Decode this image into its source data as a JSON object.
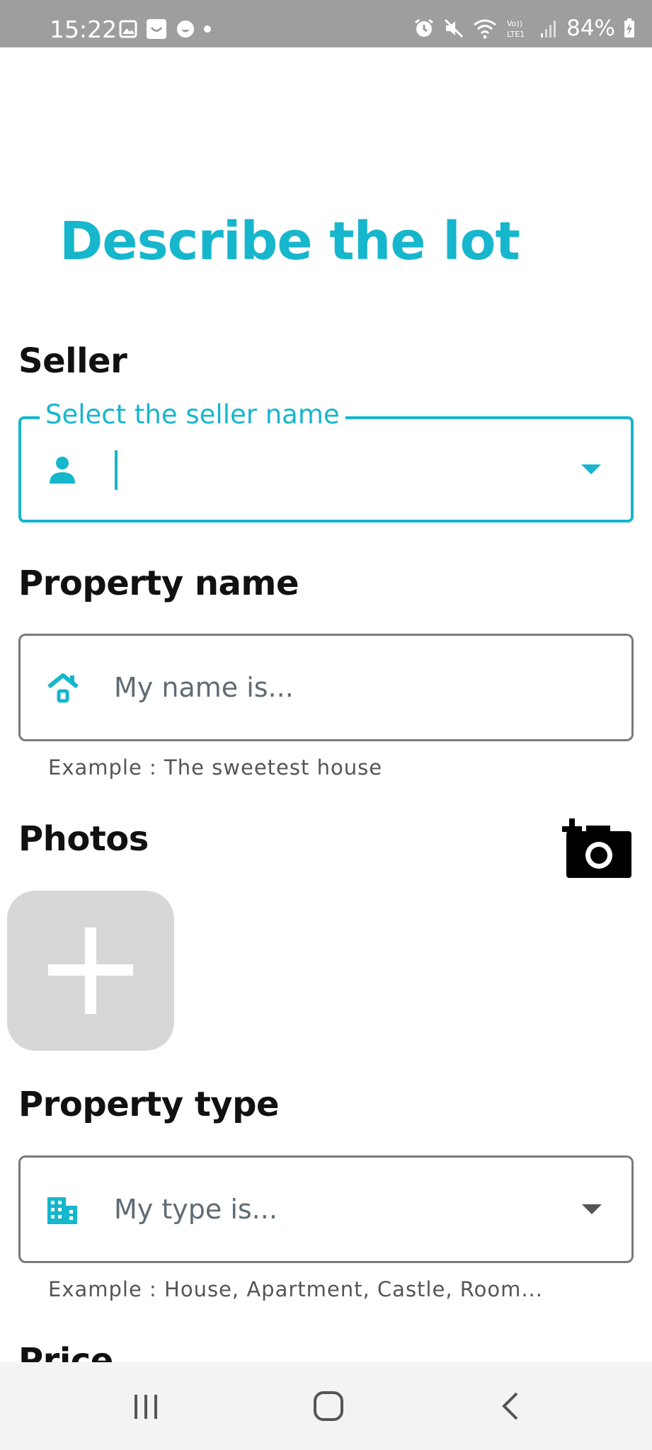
{
  "status_bar": {
    "time": "15:22",
    "battery": "84%",
    "icons": [
      "gallery-icon",
      "notification-icon",
      "emoji-icon",
      "dot-icon",
      "alarm-icon",
      "mute-icon",
      "wifi-icon",
      "volte-icon",
      "signal-icon",
      "battery-charging-icon"
    ]
  },
  "page": {
    "title": "Describe the lot"
  },
  "seller": {
    "section_label": "Seller",
    "field_label": "Select the seller name",
    "value": ""
  },
  "property_name": {
    "section_label": "Property name",
    "placeholder": "My name is...",
    "helper": "Example : The sweetest house"
  },
  "photos": {
    "section_label": "Photos"
  },
  "property_type": {
    "section_label": "Property type",
    "placeholder": "My type is...",
    "helper": "Example : House, Apartment, Castle, Room..."
  },
  "price": {
    "section_label": "Price"
  },
  "colors": {
    "accent": "#16b6cc",
    "status_bar": "#9e9e9e",
    "photo_tile": "#d7d7d7"
  }
}
